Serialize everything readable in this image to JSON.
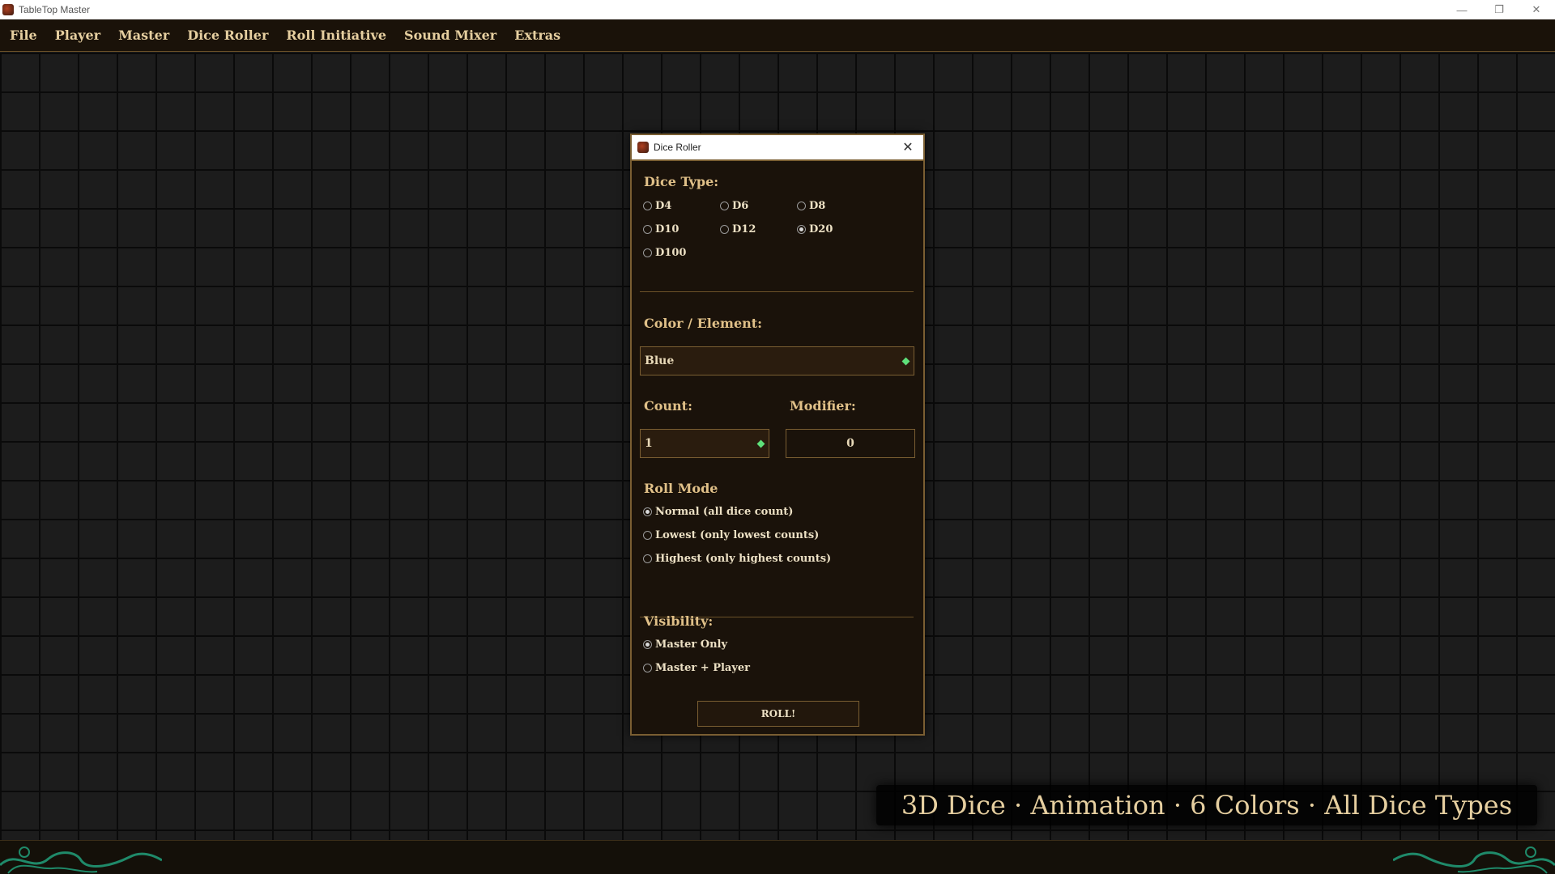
{
  "window": {
    "title": "TableTop Master",
    "controls": {
      "minimize": "—",
      "restore": "❐",
      "close": "✕"
    }
  },
  "menu": [
    "File",
    "Player",
    "Master",
    "Dice Roller",
    "Roll Initiative",
    "Sound Mixer",
    "Extras"
  ],
  "dialog": {
    "title": "Dice Roller",
    "close_glyph": "✕",
    "dice_type": {
      "label": "Dice Type:",
      "options": [
        {
          "label": "D4",
          "selected": false
        },
        {
          "label": "D6",
          "selected": false
        },
        {
          "label": "D8",
          "selected": false
        },
        {
          "label": "D10",
          "selected": false
        },
        {
          "label": "D12",
          "selected": false
        },
        {
          "label": "D20",
          "selected": true
        },
        {
          "label": "D100",
          "selected": false
        }
      ]
    },
    "color": {
      "label": "Color / Element:",
      "value": "Blue"
    },
    "count": {
      "label": "Count:",
      "value": "1"
    },
    "modifier": {
      "label": "Modifier:",
      "value": "0"
    },
    "roll_mode": {
      "label": "Roll Mode",
      "options": [
        {
          "label": "Normal (all dice count)",
          "selected": true
        },
        {
          "label": "Lowest (only lowest counts)",
          "selected": false
        },
        {
          "label": "Highest (only highest counts)",
          "selected": false
        }
      ]
    },
    "visibility": {
      "label": "Visibility:",
      "options": [
        {
          "label": "Master Only",
          "selected": true
        },
        {
          "label": "Master + Player",
          "selected": false
        }
      ]
    },
    "roll_button": "ROLL!"
  },
  "caption": "3D Dice · Animation · 6 Colors · All Dice Types",
  "colors": {
    "accent_gold": "#e0c088",
    "border_brown": "#7a5e32",
    "spinner_green": "#5ee07a",
    "ornament_teal": "#1f8a6a"
  }
}
